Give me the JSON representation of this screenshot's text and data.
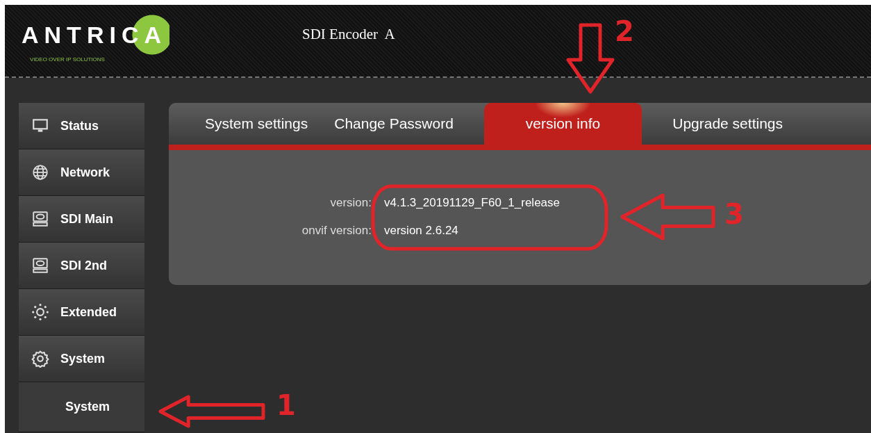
{
  "header": {
    "logo": "ANTRICA",
    "logo_tagline": "VIDEO OVER IP SOLUTIONS",
    "device_title": "SDI Encoder  A"
  },
  "sidebar": {
    "items": [
      {
        "label": "Status",
        "kind": "monitor"
      },
      {
        "label": "Network",
        "kind": "globe"
      },
      {
        "label": "SDI Main",
        "kind": "disc"
      },
      {
        "label": "SDI 2nd",
        "kind": "disc"
      },
      {
        "label": "Extended",
        "kind": "dots"
      },
      {
        "label": "System",
        "kind": "gear"
      },
      {
        "label": "System",
        "kind": "sub"
      }
    ]
  },
  "tabs": [
    {
      "label": "System settings",
      "selected": false
    },
    {
      "label": "Change Password",
      "selected": false
    },
    {
      "label": "version info",
      "selected": true
    },
    {
      "label": "Upgrade settings",
      "selected": false
    }
  ],
  "fields": [
    {
      "label": "version:",
      "value": "v4.1.3_20191129_F60_1_release"
    },
    {
      "label": "onvif version:",
      "value": "version 2.6.24"
    }
  ],
  "annotations": [
    {
      "kind": "arrow-left",
      "number": "1"
    },
    {
      "kind": "arrow-down",
      "number": "2"
    },
    {
      "kind": "arrow-left",
      "number": "3"
    }
  ]
}
